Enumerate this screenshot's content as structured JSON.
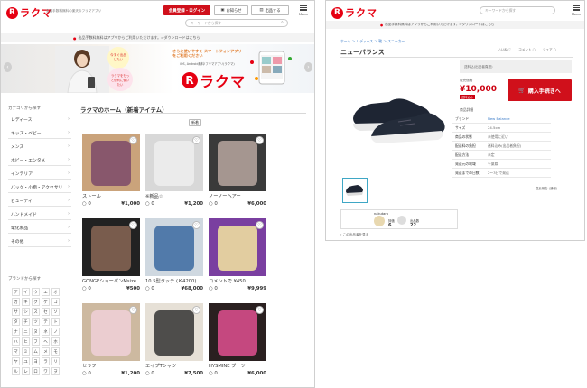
{
  "left": {
    "logo": "ラクマ",
    "tagline": "会員手数料無料の楽天のフリマアプリ",
    "header_buttons": {
      "signup": "会員登録・ログイン",
      "notice": "お知らせ",
      "sell": "出品する"
    },
    "search_placeholder": "キーワードから探す",
    "menu_label": "Menu",
    "notice_text": "出品手数料無料はアプリからご利用いただけます。⇒ダウンロードはこちら",
    "banner": {
      "bubble1": "今すぐ出品したい",
      "bubble2": "ラクマをもっと便利に使いたい",
      "headline": "さらに使いやすく スマートフォンアプリをご利用ください",
      "sub": "iOS, Android無料!フリマアプリ(ラクマ)",
      "logo": "ラクマ"
    },
    "category_title": "カテゴリから探す",
    "categories": [
      "レディース",
      "キッズ・ベビー",
      "メンズ",
      "ホビー・エンタメ",
      "インテリア",
      "バッグ・小物・アクセサリ",
      "ビューティ",
      "ハンドメイド",
      "電化製品",
      "その他"
    ],
    "brand_title": "ブランドから探す",
    "brand_letters": [
      "ア",
      "イ",
      "ウ",
      "エ",
      "オ",
      "カ",
      "キ",
      "ク",
      "ケ",
      "コ",
      "サ",
      "シ",
      "ス",
      "セ",
      "ソ",
      "タ",
      "チ",
      "ツ",
      "テ",
      "ト",
      "ナ",
      "ニ",
      "ヌ",
      "ネ",
      "ノ",
      "ハ",
      "ヒ",
      "フ",
      "ヘ",
      "ホ",
      "マ",
      "ミ",
      "ム",
      "メ",
      "モ",
      "ヤ",
      "ユ",
      "ヨ",
      "ラ",
      "リ",
      "ル",
      "レ",
      "ロ",
      "ワ",
      "ヲ"
    ],
    "main_title": "ラクマのホーム（新着アイテム）",
    "sort_label": "新着",
    "products": [
      {
        "name": "ストール",
        "likes": "0",
        "price": "¥1,000"
      },
      {
        "name": "※新品☆",
        "likes": "0",
        "price": "¥1,200"
      },
      {
        "name": "ノーノーヘアー",
        "likes": "0",
        "price": "¥6,000"
      },
      {
        "name": "GONGEショーパンMsize",
        "likes": "0",
        "price": "¥500"
      },
      {
        "name": "10.5型タッチ (Ｋ4200)...",
        "likes": "0",
        "price": "¥68,000"
      },
      {
        "name": "コメントで ¥450",
        "likes": "0",
        "price": "¥9,999"
      },
      {
        "name": "セラフ",
        "likes": "0",
        "price": "¥1,200"
      },
      {
        "name": "エイプTシャツ",
        "likes": "0",
        "price": "¥7,500"
      },
      {
        "name": "HYSMINE ブーツ",
        "likes": "0",
        "price": "¥6,000"
      }
    ]
  },
  "right": {
    "logo": "ラクマ",
    "search_placeholder": "キーワードから探す",
    "menu_label": "Menu",
    "notice_text": "出品手数料無料はアプリからご利用いただけます。⇒ダウンロードはこちら",
    "breadcrumb": "ホーム ＞ レディース ＞ 靴 ＞ スニーカー",
    "actions": {
      "like": "いいね",
      "comment": "コメント",
      "share": "シェア"
    },
    "title": "ニューバランス",
    "status_box": "送料込(出品者負担)",
    "price_label": "販売価格",
    "price": "¥10,000",
    "shipping_tag": "送料込み",
    "buy_button": "購入手続きへ",
    "specs_title": "商品詳細",
    "specs": [
      {
        "k": "ブランド",
        "v": "New Balance"
      },
      {
        "k": "サイズ",
        "v": "24.5cm"
      },
      {
        "k": "商品の状態",
        "v": "未使用に近い"
      },
      {
        "k": "配送料の負担",
        "v": "送料込み(出品者負担)"
      },
      {
        "k": "配送方法",
        "v": "未定"
      },
      {
        "k": "発送元の地域",
        "v": "千葉県"
      },
      {
        "k": "発送までの日数",
        "v": "2〜3日で発送"
      }
    ],
    "report_link": "違反報告 (通報)",
    "seller": {
      "name": "nakutaro",
      "good": "6",
      "bad": "22",
      "good_label": "評価",
      "bad_label": "出品数"
    },
    "seller_items_link": "この出品者を見る"
  },
  "colors": {
    "brand_red": "#e60012",
    "price_red": "#cc0010"
  }
}
